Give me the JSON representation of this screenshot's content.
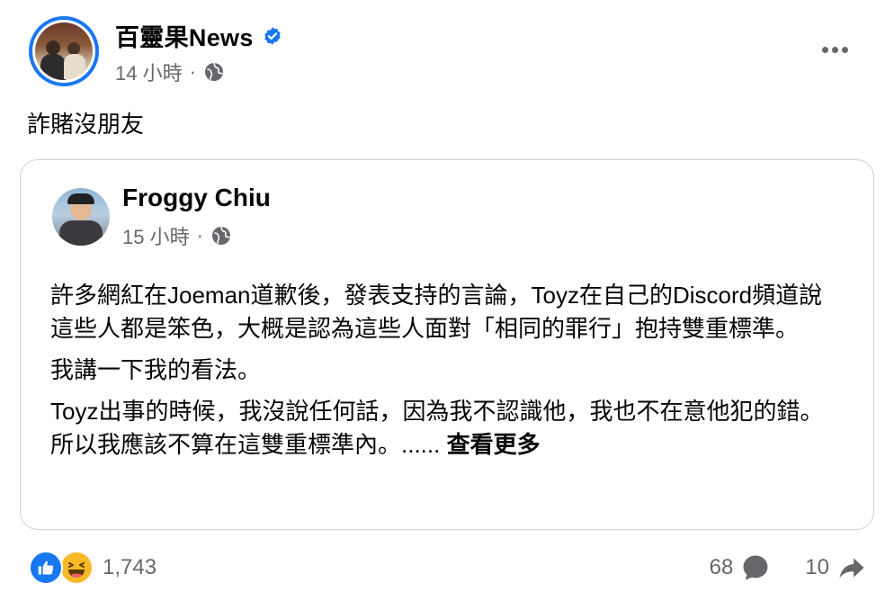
{
  "post": {
    "page_name": "百靈果News",
    "time": "14 小時",
    "dot": "·",
    "caption": "詐賭沒朋友"
  },
  "shared": {
    "name": "Froggy Chiu",
    "time": "15 小時",
    "dot": "·",
    "paragraphs": [
      "許多網紅在Joeman道歉後，發表支持的言論，Toyz在自己的Discord頻道說這些人都是笨色，大概是認為這些人面對「相同的罪行」抱持雙重標準。",
      "我講一下我的看法。",
      "Toyz出事的時候，我沒說任何話，因為我不認識他，我也不在意他犯的錯。所以我應該不算在這雙重標準內。......"
    ],
    "see_more": "查看更多"
  },
  "footer": {
    "reaction_count": "1,743",
    "comment_count": "68",
    "share_count": "10"
  },
  "icons": {
    "verified": "verified-badge-icon",
    "globe": "globe-icon",
    "more": "more-options-icon",
    "like": "like-reaction-icon",
    "haha": "haha-reaction-icon",
    "comment": "comment-icon",
    "share": "share-icon"
  },
  "colors": {
    "accent": "#1877f2",
    "secondary_text": "#65676b",
    "border": "#ced0d4",
    "haha": "#f7b928"
  }
}
